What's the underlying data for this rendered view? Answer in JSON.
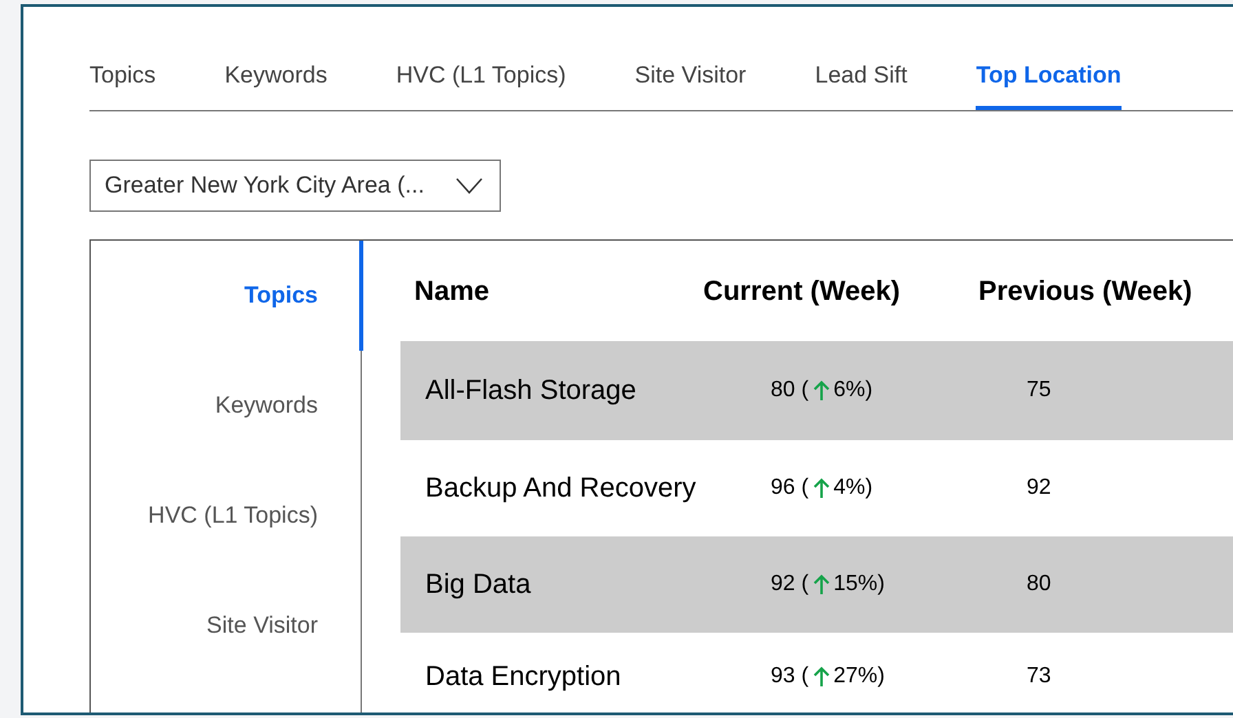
{
  "tabs": [
    {
      "label": "Topics",
      "selected": false
    },
    {
      "label": "Keywords",
      "selected": false
    },
    {
      "label": "HVC (L1 Topics)",
      "selected": false
    },
    {
      "label": "Site Visitor",
      "selected": false
    },
    {
      "label": "Lead Sift",
      "selected": false
    },
    {
      "label": "Top Location",
      "selected": true
    }
  ],
  "location_select": {
    "value": "Greater New York City Area (..."
  },
  "side_tabs": [
    {
      "label": "Topics",
      "selected": true
    },
    {
      "label": "Keywords",
      "selected": false
    },
    {
      "label": "HVC (L1 Topics)",
      "selected": false
    },
    {
      "label": "Site Visitor",
      "selected": false
    }
  ],
  "table": {
    "columns": [
      "Name",
      "Current (Week)",
      "Previous (Week)"
    ],
    "rows": [
      {
        "name": "All-Flash Storage",
        "current": "80 (",
        "kind": "up",
        "change": "6%)",
        "previous": "75"
      },
      {
        "name": "Backup And Recovery",
        "current": "96 (",
        "kind": "up",
        "change": "4%)",
        "previous": "92"
      },
      {
        "name": "Big Data",
        "current": "92 (",
        "kind": "up",
        "change": "15%)",
        "previous": "80"
      },
      {
        "name": "Data Encryption",
        "current": "93 (",
        "kind": "up",
        "change": "27%)",
        "previous": "73"
      }
    ]
  }
}
